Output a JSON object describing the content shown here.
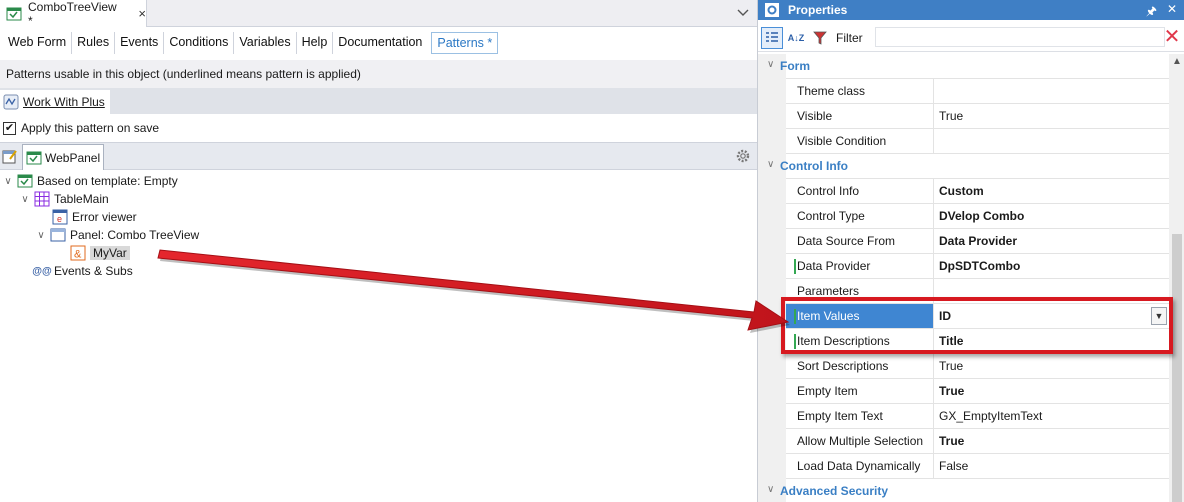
{
  "document_tab": {
    "title": "ComboTreeView *",
    "close": "×"
  },
  "subtabs": [
    "Web Form",
    "Rules",
    "Events",
    "Conditions",
    "Variables",
    "Help",
    "Documentation",
    "Patterns *"
  ],
  "patterns_note": "Patterns usable in this object (underlined means pattern is applied)",
  "pattern_tab": "Work With Plus",
  "apply_checkbox": {
    "label": "Apply this pattern on save",
    "checked": true
  },
  "webpanel_tab": "WebPanel",
  "tree": {
    "root": "Based on template: Empty",
    "table": "TableMain",
    "error_viewer": "Error viewer",
    "panel": "Panel: Combo TreeView",
    "var": "MyVar",
    "events": "Events & Subs",
    "events_icon": "@@",
    "var_icon": "&"
  },
  "properties": {
    "title": "Properties",
    "pin": "🖈",
    "close": "✕",
    "filter_label": "Filter",
    "sort_az": "A↓Z",
    "categories": {
      "form": "Form",
      "control_info": "Control Info",
      "advanced_security": "Advanced Security"
    },
    "rows": [
      {
        "name": "Theme class",
        "value": ""
      },
      {
        "name": "Visible",
        "value": "True"
      },
      {
        "name": "Visible Condition",
        "value": ""
      },
      {
        "name": "Control Info",
        "value": "Custom"
      },
      {
        "name": "Control Type",
        "value": "DVelop Combo"
      },
      {
        "name": "Data Source From",
        "value": "Data Provider"
      },
      {
        "name": "Data Provider",
        "value": "DpSDTCombo"
      },
      {
        "name": "Parameters",
        "value": ""
      },
      {
        "name": "Item Values",
        "value": "ID"
      },
      {
        "name": "Item Descriptions",
        "value": "Title"
      },
      {
        "name": "Sort Descriptions",
        "value": "True"
      },
      {
        "name": "Empty Item",
        "value": "True"
      },
      {
        "name": "Empty Item Text",
        "value": "GX_EmptyItemText"
      },
      {
        "name": "Allow Multiple Selection",
        "value": "True"
      },
      {
        "name": "Load Data Dynamically",
        "value": "False"
      }
    ]
  },
  "colors": {
    "accent": "#3f7fc5",
    "highlight": "#d71920",
    "category": "#3a7fc4"
  }
}
